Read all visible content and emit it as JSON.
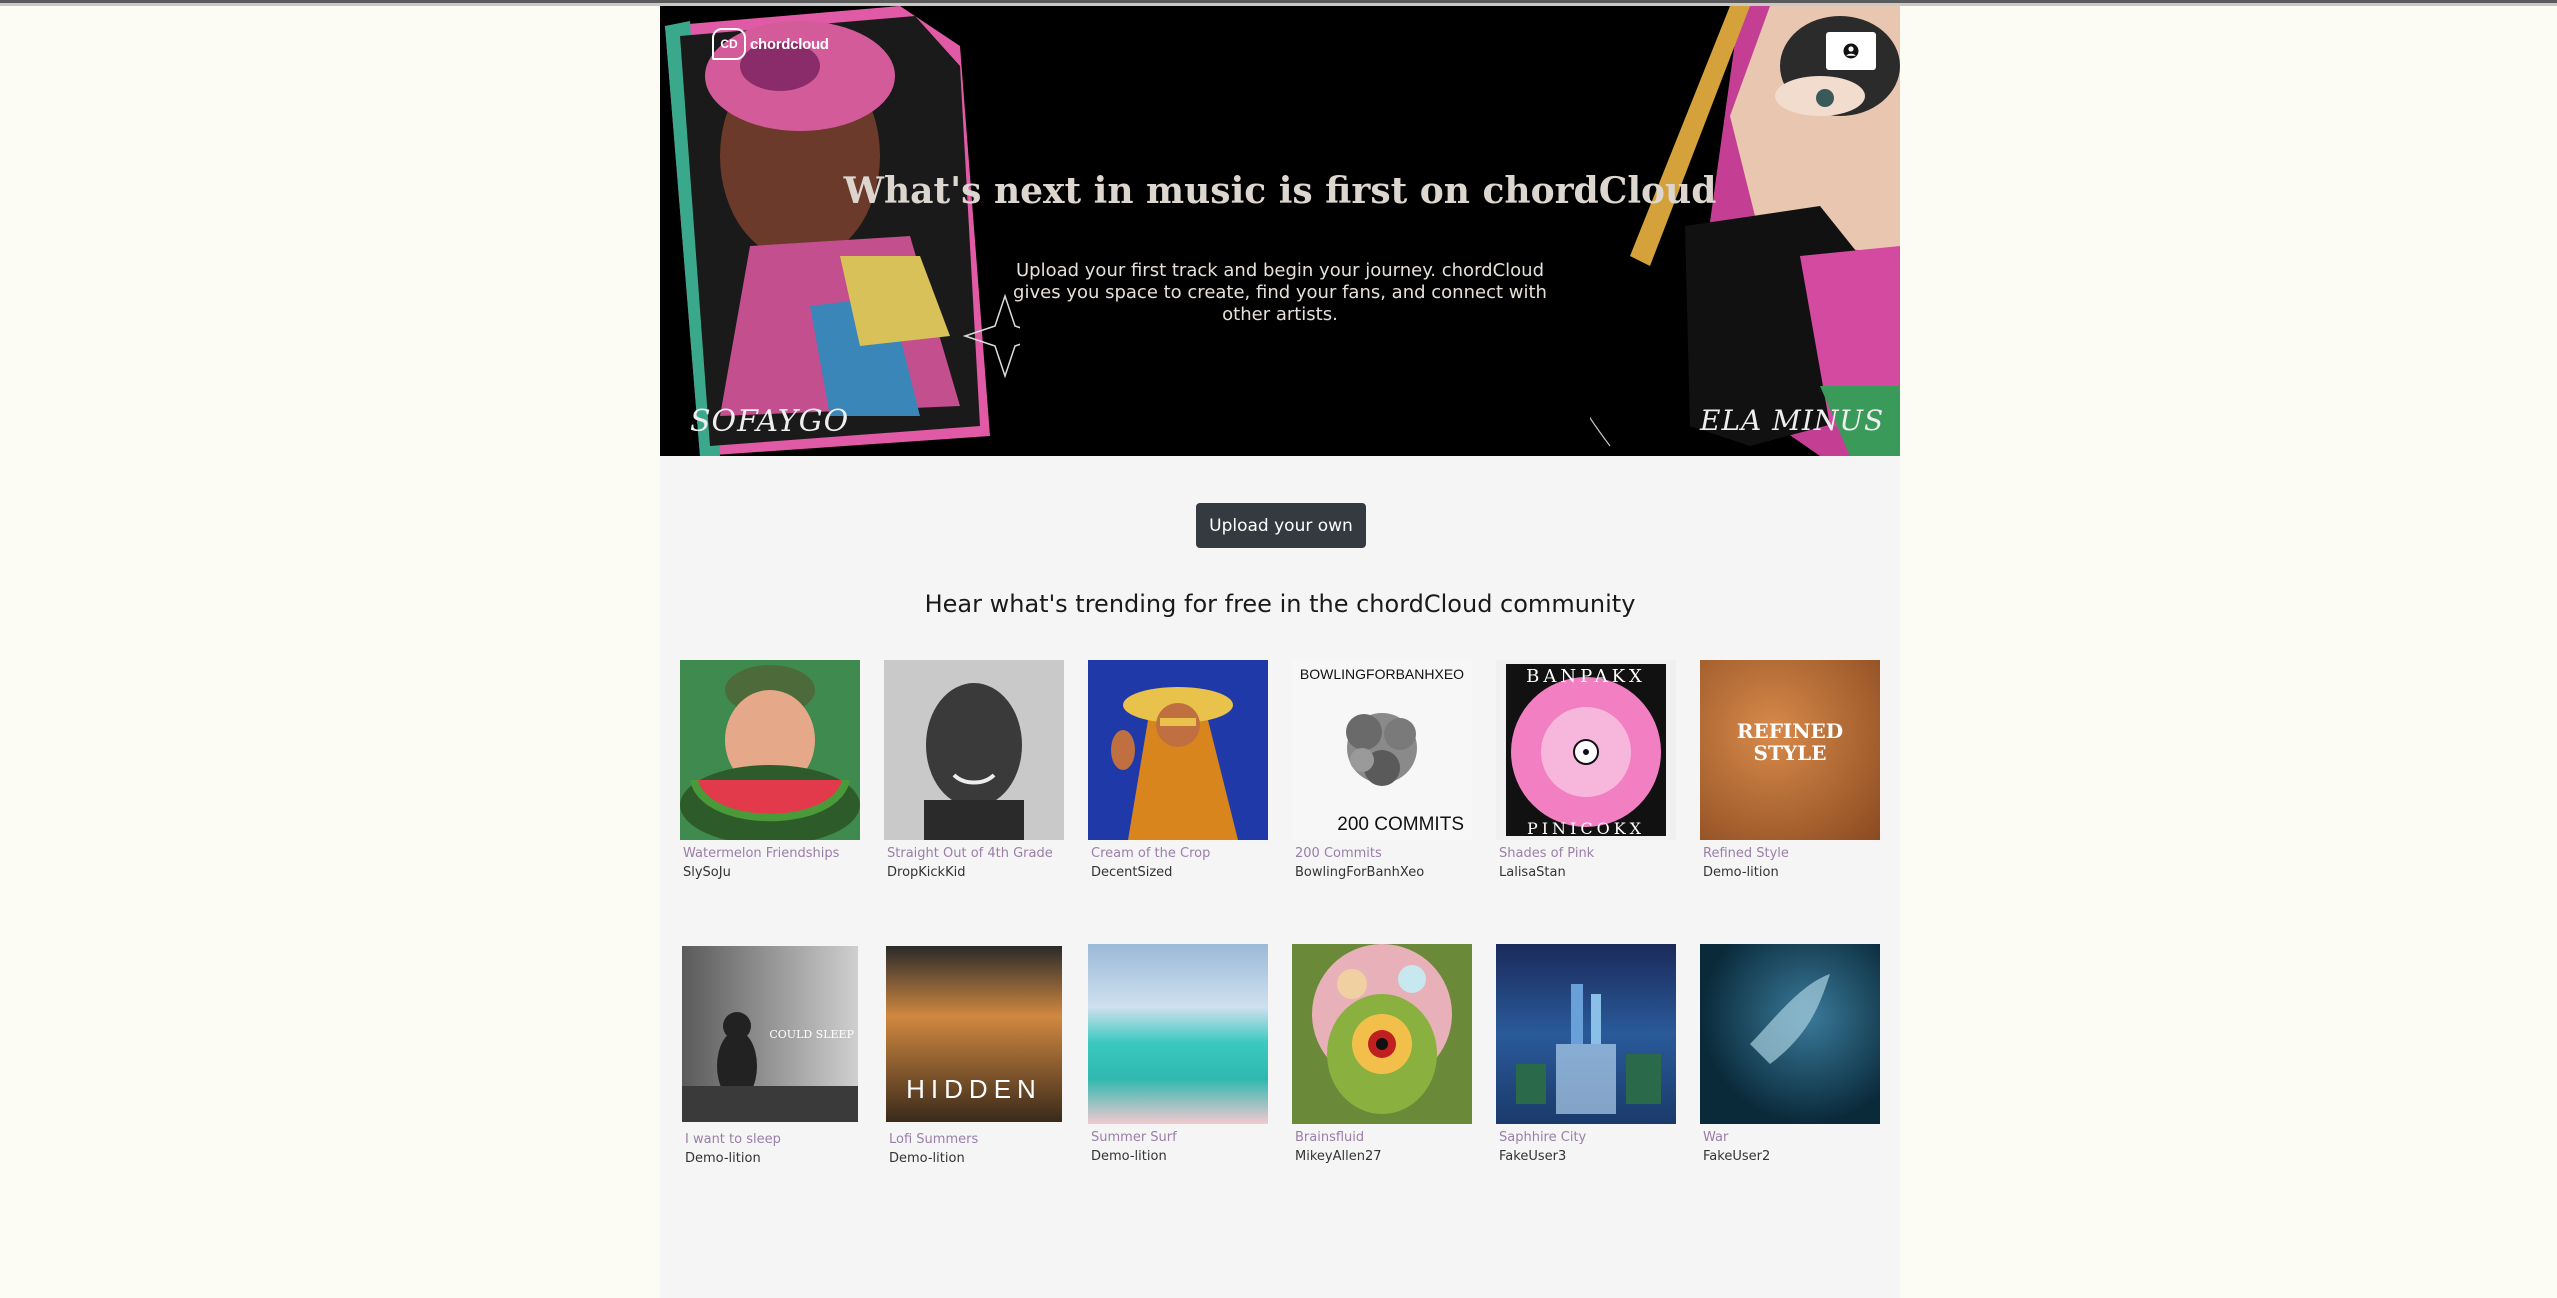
{
  "brand": {
    "name": "chordCloud",
    "logo_text": "chordcloud",
    "logo_mark": "CD"
  },
  "header": {
    "user_icon": "user-circle-icon"
  },
  "hero": {
    "title": "What's next in music is first on chordCloud",
    "subtitle": "Upload your first track and begin your journey. chordCloud gives you space to create, find your fans, and connect with other artists.",
    "signature_left": "SOFAYGO",
    "signature_right": "ELA MINUS"
  },
  "upload_button": "Upload your own",
  "trending": {
    "heading": "Hear what's trending for free in the chordCloud community",
    "tracks": [
      {
        "title": "Watermelon Friendships",
        "artist": "SlySoJu"
      },
      {
        "title": "Straight Out of 4th Grade",
        "artist": "DropKickKid"
      },
      {
        "title": "Cream of the Crop",
        "artist": "DecentSized"
      },
      {
        "title": "200 Commits",
        "artist": "BowlingForBanhXeo",
        "cover_top": "BOWLINGFORBANHXEO",
        "cover_bottom": "200 COMMITS"
      },
      {
        "title": "Shades of Pink",
        "artist": "LalisaStan",
        "cover_top": "BANPAKX",
        "cover_bottom": "PINICOKX"
      },
      {
        "title": "Refined Style",
        "artist": "Demo-lition",
        "cover_text": "REFINED STYLE"
      },
      {
        "title": "I want to sleep",
        "artist": "Demo-lition",
        "cover_text": "COULD SLEEP"
      },
      {
        "title": "Lofi Summers",
        "artist": "Demo-lition",
        "cover_text": "HIDDEN"
      },
      {
        "title": "Summer Surf",
        "artist": "Demo-lition"
      },
      {
        "title": "Brainsfluid",
        "artist": "MikeyAllen27"
      },
      {
        "title": "Saphhire City",
        "artist": "FakeUser3"
      },
      {
        "title": "War",
        "artist": "FakeUser2"
      }
    ]
  },
  "colors": {
    "page_bg": "#fcfcf4",
    "content_bg": "#f5f5f5",
    "button_bg": "#343a40",
    "track_title": "#9a7ea8"
  }
}
